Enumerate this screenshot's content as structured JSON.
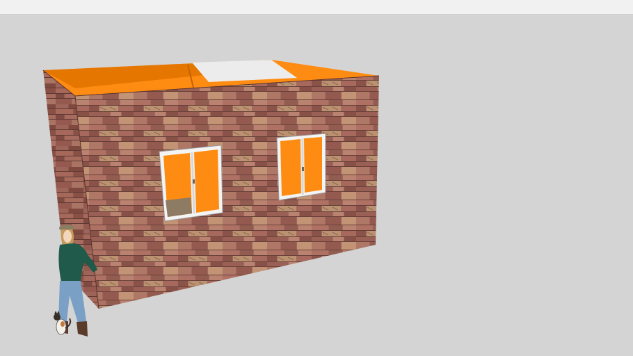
{
  "app": {
    "view": "3d-model-viewport"
  },
  "scene": {
    "model": "single-room-stone-house",
    "wall_material": "stone-brick",
    "colors": {
      "background": "#d4d4d4",
      "toolbar": "#f1f1f1",
      "interior_orange": "#ff8c12",
      "interior_orange_dark": "#e57600",
      "stone_base": "#a96f62",
      "stone_dark": "#8a534a",
      "stone_light": "#c58a77",
      "stone_tan": "#c99a76",
      "mortar": "#6f443c",
      "window_frame": "#f4f4f4"
    },
    "objects": [
      "house",
      "window-left",
      "window-right",
      "scale-figure-woman",
      "scale-figure-cat"
    ]
  }
}
